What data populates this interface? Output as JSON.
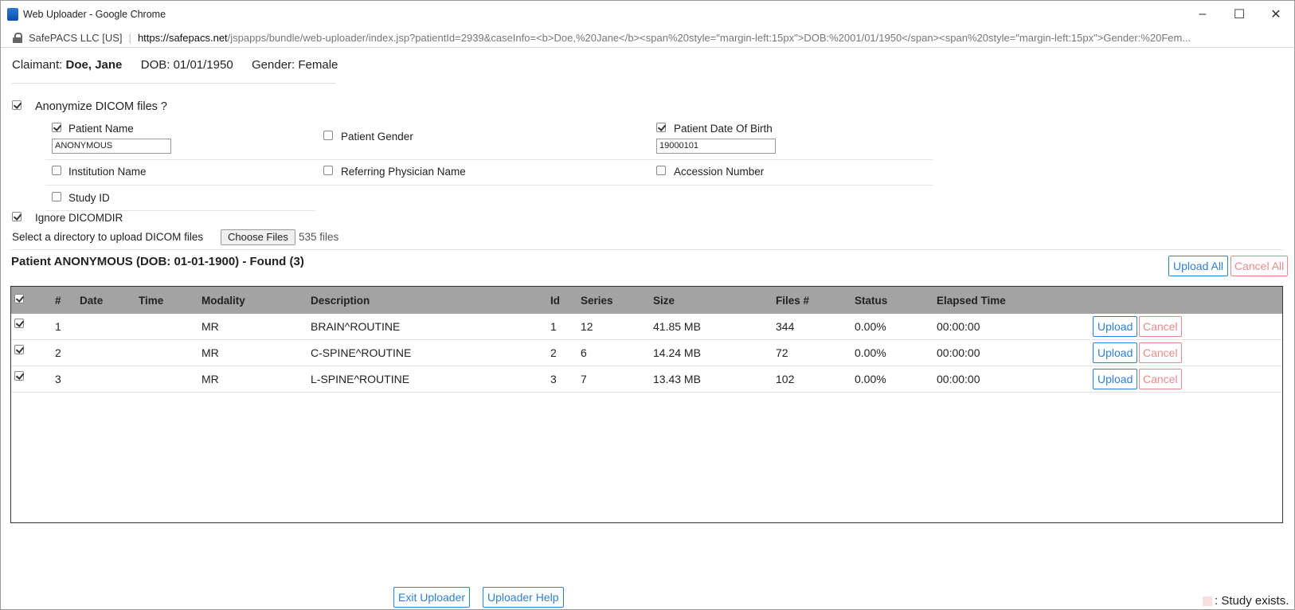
{
  "window": {
    "title": "Web Uploader - Google Chrome",
    "controls": [
      "–",
      "☐",
      "✕"
    ]
  },
  "address_bar": {
    "site_name": "SafePACS LLC [US]",
    "url_host": "https://safepacs.net",
    "url_rest": "/jspapps/bundle/web-uploader/index.jsp?patientId=2939&caseInfo=<b>Doe,%20Jane</b><span%20style=\"margin-left:15px\">DOB:%2001/01/1950</span><span%20style=\"margin-left:15px\">Gender:%20Fem..."
  },
  "claimant": {
    "label": "Claimant:",
    "name": "Doe, Jane",
    "dob": "DOB: 01/01/1950",
    "gender": "Gender: Female"
  },
  "anonymize": {
    "label": "Anonymize DICOM files ?",
    "checked": true,
    "options": {
      "patient_name": {
        "label": "Patient Name",
        "checked": true,
        "value": "ANONYMOUS"
      },
      "patient_gender": {
        "label": "Patient Gender",
        "checked": false
      },
      "patient_dob": {
        "label": "Patient Date Of Birth",
        "checked": true,
        "value": "19000101"
      },
      "institution_name": {
        "label": "Institution Name",
        "checked": false
      },
      "referring_physician": {
        "label": "Referring Physician Name",
        "checked": false
      },
      "accession_number": {
        "label": "Accession Number",
        "checked": false
      },
      "study_id": {
        "label": "Study ID",
        "checked": false
      }
    }
  },
  "ignore_dicomdir": {
    "label": "Ignore DICOMDIR",
    "checked": true
  },
  "select_dir": {
    "label": "Select a directory to upload DICOM files",
    "button": "Choose Files",
    "file_count": "535 files"
  },
  "patient_header": "Patient ANONYMOUS (DOB: 01-01-1900) - Found (3)",
  "actions": {
    "upload_all": "Upload All",
    "cancel_all": "Cancel All"
  },
  "table": {
    "headers": {
      "num": "#",
      "date": "Date",
      "time": "Time",
      "modality": "Modality",
      "description": "Description",
      "id": "Id",
      "series": "Series",
      "size": "Size",
      "files": "Files #",
      "status": "Status",
      "elapsed": "Elapsed Time"
    },
    "rows": [
      {
        "num": "1",
        "date": "",
        "time": "",
        "modality": "MR",
        "description": "BRAIN^ROUTINE",
        "id": "1",
        "series": "12",
        "size": "41.85 MB",
        "files": "344",
        "status": "0.00%",
        "elapsed": "00:00:00",
        "upload": "Upload",
        "cancel": "Cancel"
      },
      {
        "num": "2",
        "date": "",
        "time": "",
        "modality": "MR",
        "description": "C-SPINE^ROUTINE",
        "id": "2",
        "series": "6",
        "size": "14.24 MB",
        "files": "72",
        "status": "0.00%",
        "elapsed": "00:00:00",
        "upload": "Upload",
        "cancel": "Cancel"
      },
      {
        "num": "3",
        "date": "",
        "time": "",
        "modality": "MR",
        "description": "L-SPINE^ROUTINE",
        "id": "3",
        "series": "7",
        "size": "13.43 MB",
        "files": "102",
        "status": "0.00%",
        "elapsed": "00:00:00",
        "upload": "Upload",
        "cancel": "Cancel"
      }
    ]
  },
  "footer": {
    "exit": "Exit Uploader",
    "help": "Uploader Help",
    "legend": ": Study exists.",
    "legend_color": "#fbdede"
  },
  "colors": {
    "accent": "#2e7fd6",
    "danger": "#e88a8a",
    "table_header": "#a3a3a3"
  }
}
